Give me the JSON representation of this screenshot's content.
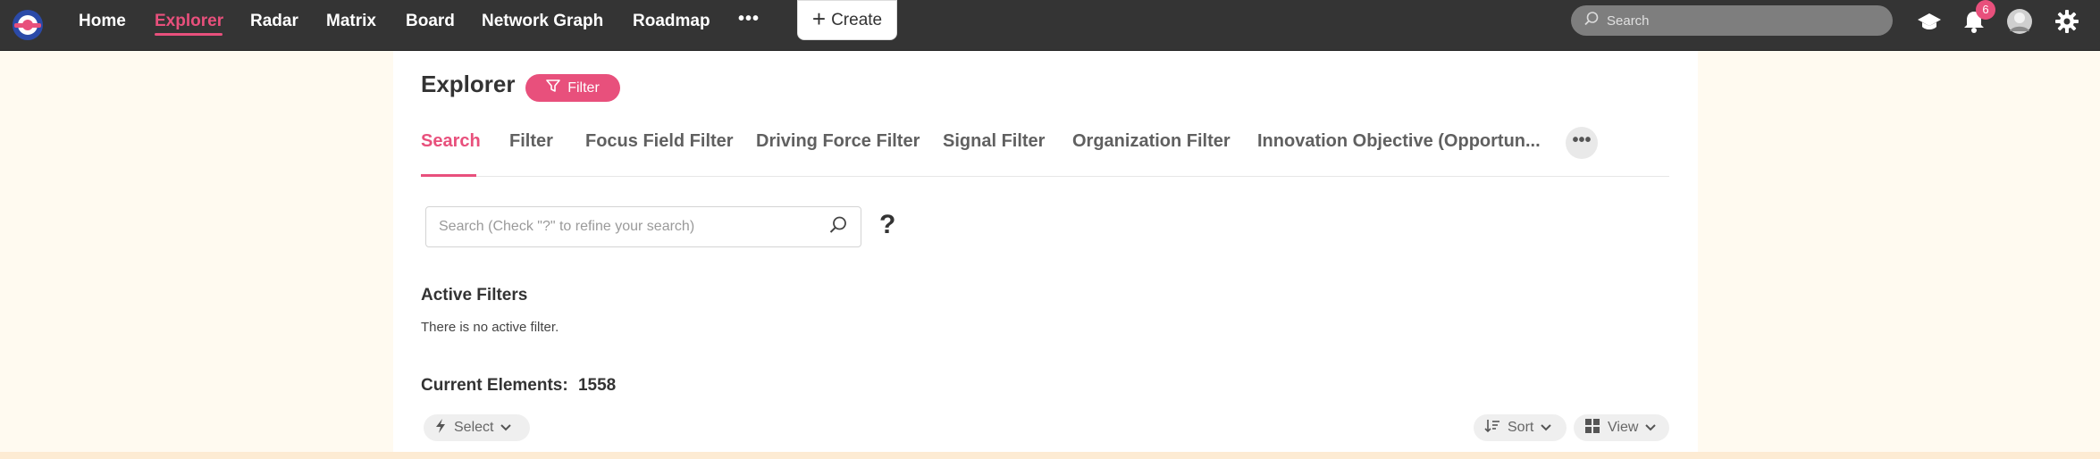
{
  "nav": {
    "items": [
      {
        "label": "Home"
      },
      {
        "label": "Explorer",
        "active": true
      },
      {
        "label": "Radar"
      },
      {
        "label": "Matrix"
      },
      {
        "label": "Board"
      },
      {
        "label": "Network Graph"
      },
      {
        "label": "Roadmap"
      }
    ],
    "more": "•••",
    "create_label": "Create",
    "search_placeholder": "Search",
    "notification_count": "6"
  },
  "page": {
    "title": "Explorer",
    "filter_label": "Filter",
    "tabs": [
      {
        "label": "Search",
        "active": true
      },
      {
        "label": "Filter"
      },
      {
        "label": "Focus Field Filter"
      },
      {
        "label": "Driving Force Filter"
      },
      {
        "label": "Signal Filter"
      },
      {
        "label": "Organization Filter"
      },
      {
        "label": "Innovation Objective (Opportun..."
      }
    ],
    "tabs_more": "•••",
    "search_placeholder": "Search (Check \"?\" to refine your search)",
    "help": "?",
    "active_filters_title": "Active Filters",
    "active_filters_text": "There is no active filter.",
    "current_elements_label": "Current Elements:",
    "current_elements_count": "1558",
    "select_label": "Select",
    "sort_label": "Sort",
    "view_label": "View"
  },
  "colors": {
    "accent": "#e8507c",
    "topbar": "#343434",
    "page_bg": "#fffaf0"
  },
  "icons": [
    "app-logo-icon",
    "search-icon",
    "graduation-cap-icon",
    "bell-icon",
    "avatar",
    "gear-icon",
    "funnel-icon",
    "magnifier-icon",
    "bolt-icon",
    "chevron-down-icon",
    "sort-icon",
    "grid-icon"
  ]
}
